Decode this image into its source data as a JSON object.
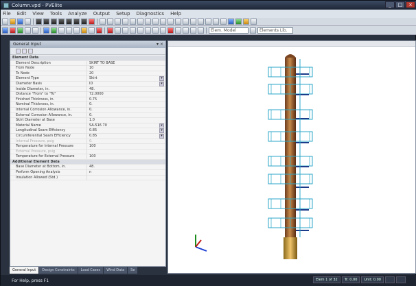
{
  "window": {
    "title": "Column.vpd - PVElite",
    "buttons": [
      "_",
      "□",
      "×"
    ]
  },
  "menu": [
    "File",
    "Edit",
    "View",
    "Tools",
    "Analyze",
    "Output",
    "Setup",
    "Diagnostics",
    "Help"
  ],
  "toolbar2": {
    "combo1": "Elem. Model",
    "combo2": "Elements Lib."
  },
  "left_panel": {
    "title": "General Input",
    "pin": "▾ ×",
    "rows": [
      {
        "name": "Element Data",
        "value": "",
        "cat": true
      },
      {
        "name": "Element Description",
        "value": "SKIRT TO BASE",
        "dd": false
      },
      {
        "name": "From Node",
        "value": "10"
      },
      {
        "name": "To Node",
        "value": "20"
      },
      {
        "name": "Element Type",
        "value": "Skirt",
        "dd": true
      },
      {
        "name": "Diameter Basis",
        "value": "ID",
        "dd": true
      },
      {
        "name": "Inside Diameter, in.",
        "value": "48."
      },
      {
        "name": "Distance \"From\" to \"To\"",
        "value": "72.0000"
      },
      {
        "name": "Finished Thickness, in.",
        "value": "0.75"
      },
      {
        "name": "Nominal Thickness, in.",
        "value": "0."
      },
      {
        "name": "Internal Corrosion Allowance, in.",
        "value": "0."
      },
      {
        "name": "External Corrosion Allowance, in.",
        "value": "0."
      },
      {
        "name": "Skirt Diameter at Base",
        "value": "1.0"
      },
      {
        "name": "Material Name",
        "value": "SA-516 70",
        "dd": true
      },
      {
        "name": "Longitudinal Seam Efficiency",
        "value": "0.85",
        "dd": true
      },
      {
        "name": "Circumferential Seam Efficiency",
        "value": "0.85",
        "dd": true
      },
      {
        "name": "Internal Pressure, psig",
        "value": "0.",
        "dim": true
      },
      {
        "name": "Temperature for Internal Pressure",
        "value": "100"
      },
      {
        "name": "External Pressure, psig",
        "value": "",
        "dim": true
      },
      {
        "name": "Temperature for External Pressure",
        "value": "100"
      },
      {
        "name": "Additional Element Data",
        "value": "",
        "cat": true
      },
      {
        "name": "Base Diameter at Bottom, in.",
        "value": "48."
      },
      {
        "name": "Perform Opening Analysis",
        "value": "n"
      },
      {
        "name": "Insulation Allowed (Std.)",
        "value": ""
      }
    ],
    "tabs": [
      "General Input",
      "Design Constraints",
      "Load Cases",
      "Wind Data",
      "Se"
    ]
  },
  "statusbar": {
    "text": "For Help, press F1",
    "cells": [
      "Elem 1 of 32",
      "Tr: 0.00",
      "Unit: 0.00",
      "",
      ""
    ]
  }
}
